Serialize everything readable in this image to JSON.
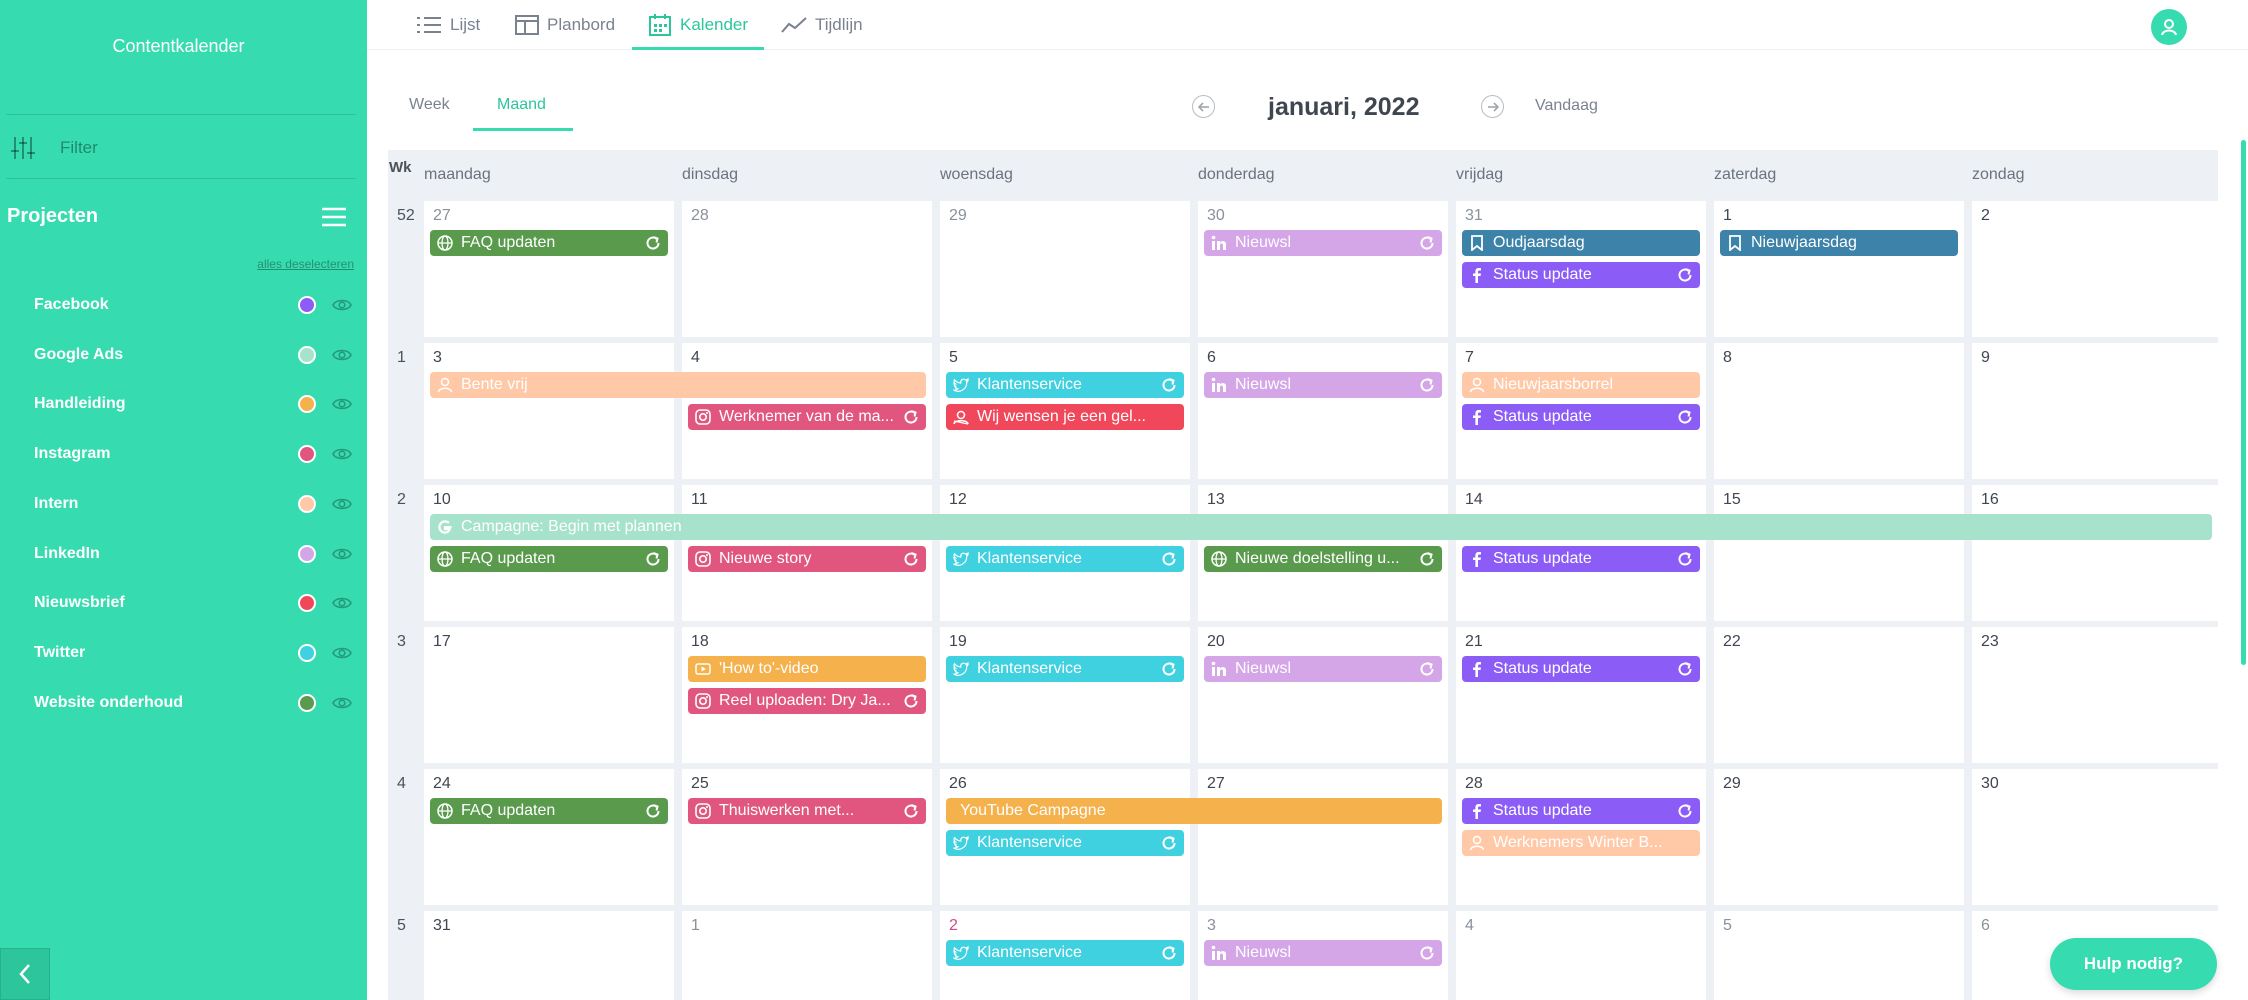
{
  "sidebar": {
    "title": "Contentkalender",
    "filter_label": "Filter",
    "projects_title": "Projecten",
    "deselect_all": "alles deselecteren",
    "projects": [
      {
        "name": "Facebook",
        "color": "#8b5cf6"
      },
      {
        "name": "Google Ads",
        "color": "#a7e2cc"
      },
      {
        "name": "Handleiding",
        "color": "#f5b14c"
      },
      {
        "name": "Instagram",
        "color": "#e0567e"
      },
      {
        "name": "Intern",
        "color": "#ffc9a8"
      },
      {
        "name": "LinkedIn",
        "color": "#d4a6e8"
      },
      {
        "name": "Nieuwsbrief",
        "color": "#f0485a"
      },
      {
        "name": "Twitter",
        "color": "#3fd1e0"
      },
      {
        "name": "Website onderhoud",
        "color": "#5a9a4d"
      }
    ]
  },
  "nav": {
    "tabs": [
      {
        "label": "Lijst"
      },
      {
        "label": "Planbord"
      },
      {
        "label": "Kalender",
        "active": true
      },
      {
        "label": "Tijdlijn"
      }
    ]
  },
  "toolbar": {
    "views": [
      {
        "label": "Week"
      },
      {
        "label": "Maand",
        "active": true
      }
    ],
    "month_title": "januari, 2022",
    "today_label": "Vandaag"
  },
  "calendar": {
    "week_header": "Wk",
    "days": [
      "maandag",
      "dinsdag",
      "woensdag",
      "donderdag",
      "vrijdag",
      "zaterdag",
      "zondag"
    ],
    "weeks": [
      {
        "number": "52",
        "dates": [
          "27",
          "28",
          "29",
          "30",
          "31",
          "1",
          "2"
        ],
        "other_month": [
          true,
          true,
          true,
          true,
          true,
          false,
          false
        ]
      },
      {
        "number": "1",
        "dates": [
          "3",
          "4",
          "5",
          "6",
          "7",
          "8",
          "9"
        ],
        "other_month": [
          false,
          false,
          false,
          false,
          false,
          false,
          false
        ]
      },
      {
        "number": "2",
        "dates": [
          "10",
          "11",
          "12",
          "13",
          "14",
          "15",
          "16"
        ],
        "other_month": [
          false,
          false,
          false,
          false,
          false,
          false,
          false
        ]
      },
      {
        "number": "3",
        "dates": [
          "17",
          "18",
          "19",
          "20",
          "21",
          "22",
          "23"
        ],
        "other_month": [
          false,
          false,
          false,
          false,
          false,
          false,
          false
        ]
      },
      {
        "number": "4",
        "dates": [
          "24",
          "25",
          "26",
          "27",
          "28",
          "29",
          "30"
        ],
        "other_month": [
          false,
          false,
          false,
          false,
          false,
          false,
          false
        ]
      },
      {
        "number": "5",
        "dates": [
          "31",
          "1",
          "2",
          "3",
          "4",
          "5",
          "6"
        ],
        "other_month": [
          false,
          true,
          true,
          true,
          true,
          true,
          true
        ],
        "today": [
          false,
          false,
          true,
          false,
          false,
          false,
          false
        ]
      }
    ],
    "events": [
      {
        "label": "FAQ updaten",
        "icon": "globe-icon",
        "color": "#5a9a4d",
        "week": 0,
        "day": 0,
        "span": 1,
        "slot": 0,
        "repeat": true
      },
      {
        "label": "Nieuwsl",
        "icon": "linkedin-icon",
        "color": "#d4a6e8",
        "week": 0,
        "day": 3,
        "span": 1,
        "slot": 0,
        "repeat": true
      },
      {
        "label": "Oudjaarsdag",
        "icon": "bookmark-icon",
        "color": "#3d83a9",
        "week": 0,
        "day": 4,
        "span": 1,
        "slot": 0,
        "repeat": false
      },
      {
        "label": "Status update",
        "icon": "facebook-icon",
        "color": "#8b5cf6",
        "week": 0,
        "day": 4,
        "span": 1,
        "slot": 1,
        "repeat": true
      },
      {
        "label": "Nieuwjaarsdag",
        "icon": "bookmark-icon",
        "color": "#3d83a9",
        "week": 0,
        "day": 5,
        "span": 1,
        "slot": 0,
        "repeat": false
      },
      {
        "label": "Bente vrij",
        "icon": "user-icon",
        "color": "#ffc9a8",
        "week": 1,
        "day": 0,
        "span": 2,
        "slot": 0,
        "repeat": false
      },
      {
        "label": "Werknemer van de ma...",
        "icon": "instagram-icon",
        "color": "#e0567e",
        "week": 1,
        "day": 1,
        "span": 1,
        "slot": 1,
        "repeat": true
      },
      {
        "label": "Klantenservice",
        "icon": "twitter-icon",
        "color": "#3fd1e0",
        "week": 1,
        "day": 2,
        "span": 1,
        "slot": 0,
        "repeat": true
      },
      {
        "label": "Wij wensen je een gel...",
        "icon": "newsletter-icon",
        "color": "#f0485a",
        "week": 1,
        "day": 2,
        "span": 1,
        "slot": 1,
        "repeat": false
      },
      {
        "label": "Nieuwsl",
        "icon": "linkedin-icon",
        "color": "#d4a6e8",
        "week": 1,
        "day": 3,
        "span": 1,
        "slot": 0,
        "repeat": true
      },
      {
        "label": "Nieuwjaarsborrel",
        "icon": "user-icon",
        "color": "#ffc9a8",
        "week": 1,
        "day": 4,
        "span": 1,
        "slot": 0,
        "repeat": false
      },
      {
        "label": "Status update",
        "icon": "facebook-icon",
        "color": "#8b5cf6",
        "week": 1,
        "day": 4,
        "span": 1,
        "slot": 1,
        "repeat": true
      },
      {
        "label": "Campagne: Begin met plannen",
        "icon": "google-icon",
        "color": "#a7e2cc",
        "week": 2,
        "day": 0,
        "span": 7,
        "slot": 0,
        "repeat": false
      },
      {
        "label": "FAQ updaten",
        "icon": "globe-icon",
        "color": "#5a9a4d",
        "week": 2,
        "day": 0,
        "span": 1,
        "slot": 1,
        "repeat": true
      },
      {
        "label": "Nieuwe story",
        "icon": "instagram-icon",
        "color": "#e0567e",
        "week": 2,
        "day": 1,
        "span": 1,
        "slot": 1,
        "repeat": true
      },
      {
        "label": "Klantenservice",
        "icon": "twitter-icon",
        "color": "#3fd1e0",
        "week": 2,
        "day": 2,
        "span": 1,
        "slot": 1,
        "repeat": true
      },
      {
        "label": "Nieuwe doelstelling u...",
        "icon": "globe-icon",
        "color": "#5a9a4d",
        "week": 2,
        "day": 3,
        "span": 1,
        "slot": 1,
        "repeat": true
      },
      {
        "label": "Status update",
        "icon": "facebook-icon",
        "color": "#8b5cf6",
        "week": 2,
        "day": 4,
        "span": 1,
        "slot": 1,
        "repeat": true
      },
      {
        "label": "'How to'-video",
        "icon": "video-icon",
        "color": "#f5b14c",
        "week": 3,
        "day": 1,
        "span": 1,
        "slot": 0,
        "repeat": false
      },
      {
        "label": "Reel uploaden: Dry Ja...",
        "icon": "instagram-icon",
        "color": "#e0567e",
        "week": 3,
        "day": 1,
        "span": 1,
        "slot": 1,
        "repeat": true
      },
      {
        "label": "Klantenservice",
        "icon": "twitter-icon",
        "color": "#3fd1e0",
        "week": 3,
        "day": 2,
        "span": 1,
        "slot": 0,
        "repeat": true
      },
      {
        "label": "Nieuwsl",
        "icon": "linkedin-icon",
        "color": "#d4a6e8",
        "week": 3,
        "day": 3,
        "span": 1,
        "slot": 0,
        "repeat": true
      },
      {
        "label": "Status update",
        "icon": "facebook-icon",
        "color": "#8b5cf6",
        "week": 3,
        "day": 4,
        "span": 1,
        "slot": 0,
        "repeat": true
      },
      {
        "label": "FAQ updaten",
        "icon": "globe-icon",
        "color": "#5a9a4d",
        "week": 4,
        "day": 0,
        "span": 1,
        "slot": 0,
        "repeat": true
      },
      {
        "label": "Thuiswerken met...",
        "icon": "instagram-icon",
        "color": "#e0567e",
        "week": 4,
        "day": 1,
        "span": 1,
        "slot": 0,
        "repeat": true
      },
      {
        "label": "YouTube Campagne",
        "icon": "",
        "color": "#f5b14c",
        "week": 4,
        "day": 2,
        "span": 2,
        "slot": 0,
        "repeat": false
      },
      {
        "label": "Klantenservice",
        "icon": "twitter-icon",
        "color": "#3fd1e0",
        "week": 4,
        "day": 2,
        "span": 1,
        "slot": 1,
        "repeat": true
      },
      {
        "label": "Status update",
        "icon": "facebook-icon",
        "color": "#8b5cf6",
        "week": 4,
        "day": 4,
        "span": 1,
        "slot": 0,
        "repeat": true
      },
      {
        "label": "Werknemers Winter B...",
        "icon": "user-icon",
        "color": "#ffc9a8",
        "week": 4,
        "day": 4,
        "span": 1,
        "slot": 1,
        "repeat": false
      },
      {
        "label": "Klantenservice",
        "icon": "twitter-icon",
        "color": "#3fd1e0",
        "week": 5,
        "day": 2,
        "span": 1,
        "slot": 0,
        "repeat": true
      },
      {
        "label": "Nieuwsl",
        "icon": "linkedin-icon",
        "color": "#d4a6e8",
        "week": 5,
        "day": 3,
        "span": 1,
        "slot": 0,
        "repeat": true
      }
    ]
  },
  "help_button": "Hulp nodig?"
}
